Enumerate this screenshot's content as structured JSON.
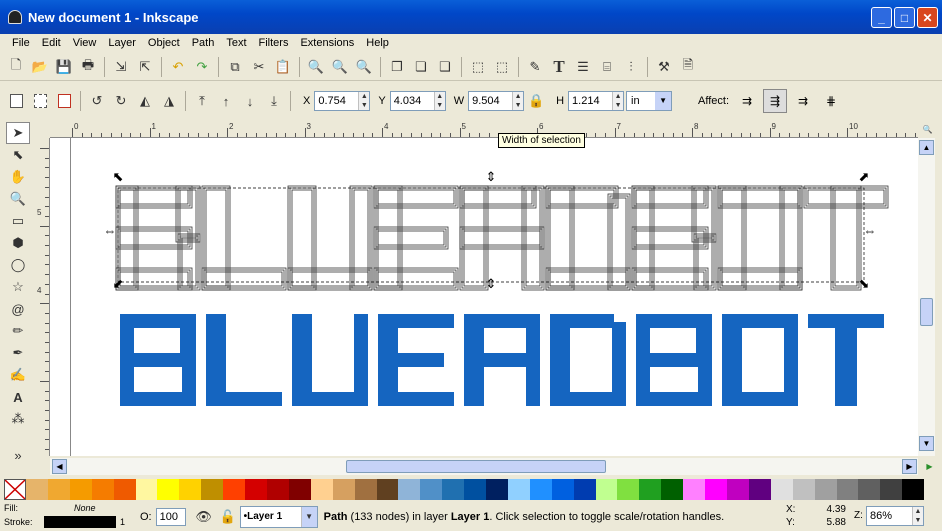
{
  "window": {
    "title": "New document 1 - Inkscape"
  },
  "menu": [
    "File",
    "Edit",
    "View",
    "Layer",
    "Object",
    "Path",
    "Text",
    "Filters",
    "Extensions",
    "Help"
  ],
  "controls": {
    "x_label": "X",
    "x_value": "0.754",
    "y_label": "Y",
    "y_value": "4.034",
    "w_label": "W",
    "w_value": "9.504",
    "h_label": "H",
    "h_value": "1.214",
    "units": "in",
    "affect_label": "Affect:"
  },
  "tooltip": "Width of selection",
  "ruler": {
    "h_ticks": [
      "0",
      "1",
      "2",
      "3",
      "4",
      "5",
      "6",
      "7",
      "8",
      "9",
      "10"
    ],
    "v_ticks": [
      "5",
      "4"
    ]
  },
  "canvas_text": "BLUERDBOT",
  "colors": {
    "accent": "#1565c0",
    "titlebar": "#0047c8"
  },
  "palette": [
    "#e6b46a",
    "#f0a830",
    "#f59b00",
    "#f57c00",
    "#ef5a00",
    "#fff7a0",
    "#ffff00",
    "#ffd200",
    "#bf8f00",
    "#ff4000",
    "#d40000",
    "#b00000",
    "#800000",
    "#ffd090",
    "#d6a060",
    "#a07040",
    "#604020",
    "#8fb4d8",
    "#5090c8",
    "#2070b0",
    "#0050a0",
    "#002060",
    "#90d0ff",
    "#2090ff",
    "#0060e0",
    "#003cb0",
    "#c0ff90",
    "#80e040",
    "#20a020",
    "#006000",
    "#ff80ff",
    "#ff00ff",
    "#c000c0",
    "#600080",
    "#e0e0e0",
    "#c0c0c0",
    "#a0a0a0",
    "#808080",
    "#606060",
    "#404040",
    "#000000"
  ],
  "status": {
    "fill_label": "Fill:",
    "fill_value": "None",
    "stroke_label": "Stroke:",
    "stroke_value": "1",
    "opacity_label": "O:",
    "opacity_value": "100",
    "layer": "•Layer 1",
    "message_bold": "Path",
    "message_rest": " (133 nodes) in layer ",
    "message_layer": "Layer 1",
    "message_tail": ". Click selection to toggle scale/rotation handles.",
    "x_label": "X:",
    "x_value": "4.39",
    "y_label": "Y:",
    "y_value": "5.88",
    "zoom_label": "Z:",
    "zoom_value": "86%"
  }
}
